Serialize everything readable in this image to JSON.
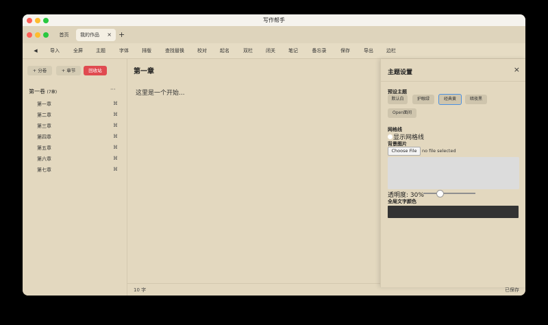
{
  "window": {
    "title": "写作帮手"
  },
  "tabs": [
    {
      "label": "首页"
    },
    {
      "label": "我的作品",
      "close": "×"
    }
  ],
  "new_tab": "+",
  "toolbar": {
    "back": "◀",
    "items": [
      "导入",
      "全屏",
      "主题",
      "字体",
      "排版",
      "查找替换",
      "校对",
      "起名",
      "双栏",
      "闭关",
      "笔记",
      "备忘录",
      "保存",
      "导出",
      "边栏"
    ]
  },
  "sidebar": {
    "add_volume": "+ 分卷",
    "add_chapter": "+ 章节",
    "recycle": "回收站",
    "volume": {
      "title": "第一卷",
      "count": "(7章)",
      "more": "···"
    },
    "chapters": [
      {
        "label": "第一章",
        "icon": "⌘"
      },
      {
        "label": "第二章",
        "icon": "⌘"
      },
      {
        "label": "第三章",
        "icon": "⌘"
      },
      {
        "label": "第四章",
        "icon": "⌘"
      },
      {
        "label": "第五章",
        "icon": "⌘"
      },
      {
        "label": "第六章",
        "icon": "⌘"
      },
      {
        "label": "第七章",
        "icon": "⌘"
      }
    ]
  },
  "editor": {
    "title": "第一章",
    "content": "这里是一个开始..."
  },
  "status": {
    "word_count": "10 字",
    "saved": "已保存"
  },
  "theme_panel": {
    "title": "主题设置",
    "close": "×",
    "preset_label": "预设主题",
    "presets": [
      "默认白",
      "护眼绿",
      "经典黄",
      "暗夜黑",
      "Open面间"
    ],
    "selected_preset": "经典黄",
    "grid_label": "网格线",
    "grid_checkbox_label": "显示网格线",
    "grid_enabled": false,
    "bg_image_label": "背景图片",
    "choose_file": "Choose File",
    "no_file": "no file selected",
    "opacity_label": "透明度: 30%",
    "opacity_value": 0.3,
    "text_color_label": "全局文字颜色",
    "text_color": "#333333"
  },
  "colors": {
    "accent_red": "#e04a50",
    "selected_border": "#4a90e2",
    "background": "#e3d8bf"
  }
}
